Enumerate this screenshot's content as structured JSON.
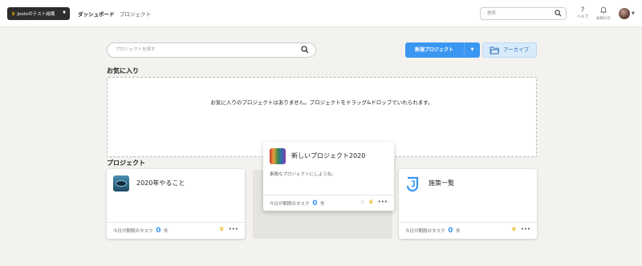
{
  "header": {
    "org_name": "Jootoのテスト組織",
    "nav": {
      "dashboard": "ダッシュボード",
      "projects": "プロジェクト"
    },
    "search_placeholder": "検索",
    "help_label": "ヘルプ",
    "notifications_label": "お知らせ"
  },
  "toolbar": {
    "search_placeholder": "プロジェクトを探す",
    "new_project_label": "新規プロジェクト",
    "archive_label": "アーカイブ"
  },
  "favorites": {
    "title": "お気に入り",
    "empty_message": "お気に入りのプロジェクトはありません。プロジェクトをドラッグ&ドロップでいれられます。"
  },
  "projects": {
    "title": "プロジェクト",
    "cards": [
      {
        "name": "2020年やること",
        "due_label": "今日が期限のタスク",
        "count": "0",
        "unit": "件"
      },
      {
        "name": "施策一覧",
        "due_label": "今日が期限のタスク",
        "count": "0",
        "unit": "件"
      }
    ],
    "dragging": {
      "name": "新しいプロジェクト2020",
      "description": "素敵なプロジェクトにしようね。",
      "due_label": "今日が期限のタスク",
      "count": "0",
      "unit": "件"
    }
  },
  "colors": {
    "accent": "#3a97f1",
    "header_bg": "#ffffff",
    "page_bg": "#f3f2ef",
    "crown": "#e8b400"
  }
}
